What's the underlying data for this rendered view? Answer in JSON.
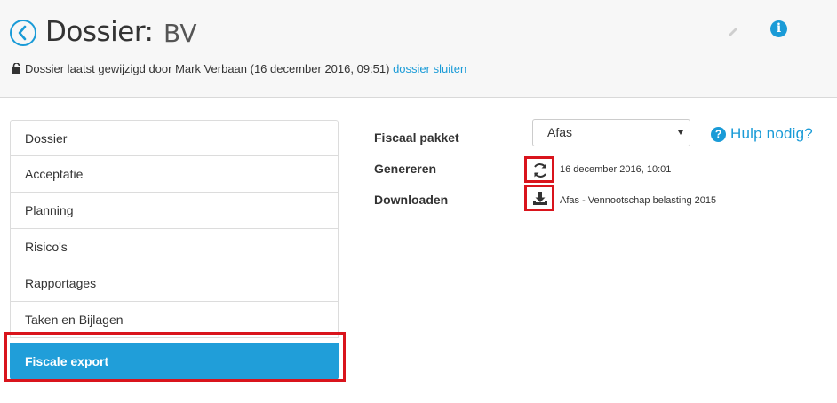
{
  "header": {
    "title_prefix": "Dossier:",
    "title_name": "BV",
    "status_text": "Dossier laatst gewijzigd door Mark Verbaan (16 december 2016, 09:51)",
    "close_link": "dossier sluiten",
    "info_glyph": "i",
    "icons": [
      "back-arrow-icon",
      "lock-open-icon",
      "pencil-icon",
      "info-icon"
    ]
  },
  "menu": {
    "items": [
      {
        "label": "Dossier"
      },
      {
        "label": "Acceptatie"
      },
      {
        "label": "Planning"
      },
      {
        "label": "Risico's"
      },
      {
        "label": "Rapportages"
      },
      {
        "label": "Taken en Bijlagen"
      },
      {
        "label": "Fiscale export",
        "active": true
      }
    ]
  },
  "form": {
    "package_label": "Fiscaal pakket",
    "package_value": "Afas",
    "help_label": "Hulp nodig?",
    "help_glyph": "?",
    "generate_label": "Genereren",
    "generate_timestamp": "16 december 2016, 10:01",
    "download_label": "Downloaden",
    "download_file": "Afas - Vennootschap belasting 2015",
    "icons": [
      "refresh-icon",
      "download-icon",
      "help-icon"
    ]
  },
  "colors": {
    "accent": "#1a9bd7",
    "active_menu": "#209ed9",
    "highlight": "#d9141c"
  }
}
